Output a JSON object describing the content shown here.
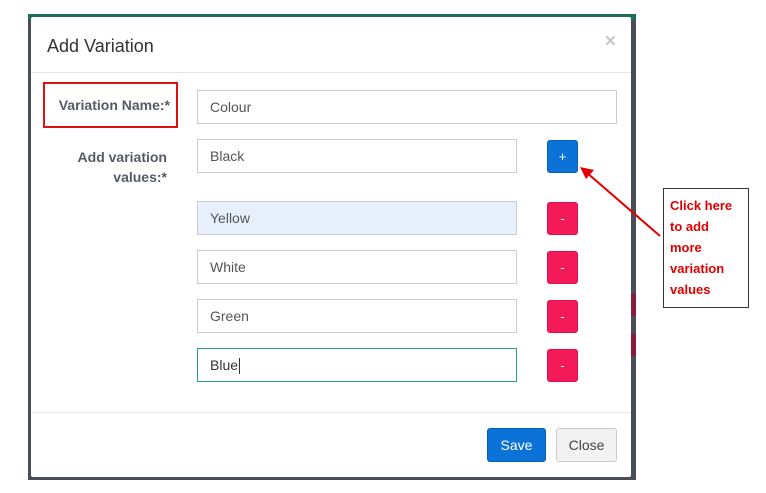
{
  "modal": {
    "title": "Add Variation",
    "close_symbol": "×"
  },
  "form": {
    "variation_name_label": "Variation Name:*",
    "variation_name_value": "Colour",
    "values_label": "Add variation values:*",
    "values": [
      "Black",
      "Yellow",
      "White",
      "Green",
      "Blue"
    ],
    "add_symbol": "+",
    "remove_symbol": "-"
  },
  "footer": {
    "save_label": "Save",
    "close_label": "Close"
  },
  "annotation": {
    "callout_text": "Click here to add more variation values",
    "color": "#e00000"
  },
  "colors": {
    "primary": "#0b72d8",
    "danger": "#f41a5a",
    "highlight": "#e01010"
  }
}
